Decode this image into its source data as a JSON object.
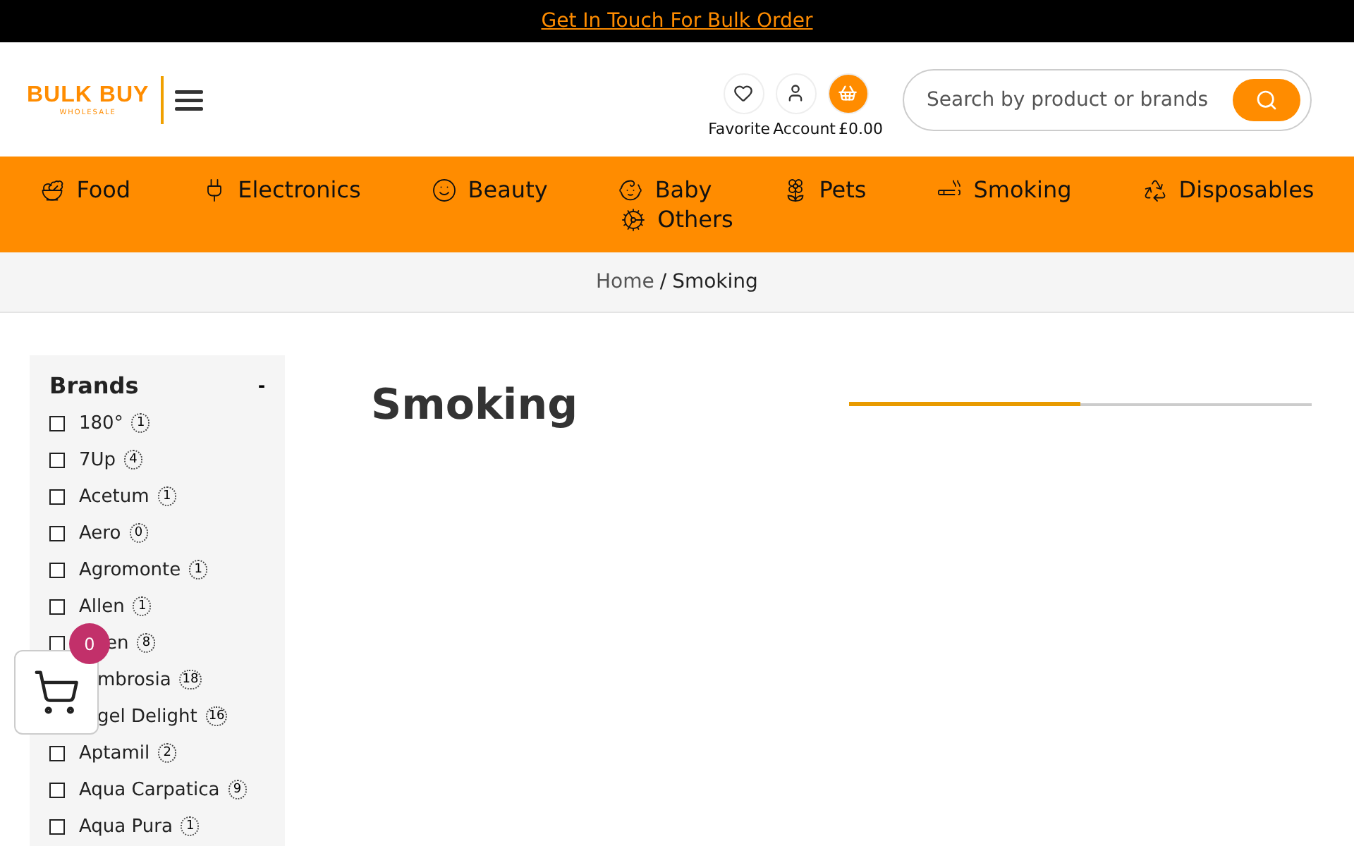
{
  "top_bar": {
    "link": "Get In Touch For Bulk Order"
  },
  "header": {
    "logo": "BULK BUY",
    "logo_sub": "WHOLESALE",
    "actions": [
      {
        "kind": "heart",
        "label": "Favorite"
      },
      {
        "kind": "user",
        "label": "Account"
      },
      {
        "kind": "basket",
        "label": "£0.00"
      }
    ],
    "search": {
      "placeholder": "Search by product or brands"
    }
  },
  "nav": [
    {
      "kind": "food",
      "label": "Food"
    },
    {
      "kind": "electronics",
      "label": "Electronics"
    },
    {
      "kind": "beauty",
      "label": "Beauty"
    },
    {
      "kind": "baby",
      "label": "Baby"
    },
    {
      "kind": "pets",
      "label": "Pets"
    },
    {
      "kind": "smoking",
      "label": "Smoking"
    },
    {
      "kind": "disposables",
      "label": "Disposables"
    },
    {
      "kind": "others",
      "label": "Others"
    }
  ],
  "breadcrumb": {
    "home": "Home",
    "separator": "/",
    "current": "Smoking"
  },
  "sidebar": {
    "title": "Brands",
    "toggle": "-",
    "items": [
      {
        "kind": "row",
        "name": "180°",
        "count": "1",
        "checked": false
      },
      {
        "kind": "row",
        "name": "7Up",
        "count": "4",
        "checked": false
      },
      {
        "kind": "row",
        "name": "Acetum",
        "count": "1",
        "checked": false
      },
      {
        "kind": "row",
        "name": "Aero",
        "count": "0",
        "checked": false
      },
      {
        "kind": "row",
        "name": "Agromonte",
        "count": "1",
        "checked": false
      },
      {
        "kind": "row",
        "name": "Allen",
        "count": "1",
        "checked": false
      },
      {
        "kind": "tail",
        "name": "en",
        "count": "8",
        "checked": false
      },
      {
        "kind": "fragment",
        "name": "mbrosia",
        "count": "18"
      },
      {
        "kind": "fragment",
        "name": "gel Delight",
        "count": "16"
      },
      {
        "kind": "row",
        "name": "Aptamil",
        "count": "2",
        "checked": false
      },
      {
        "kind": "row",
        "name": "Aqua Carpatica",
        "count": "9",
        "checked": false
      },
      {
        "kind": "row",
        "name": "Aqua Pura",
        "count": "1",
        "checked": false
      }
    ]
  },
  "page_title": "Smoking",
  "floating_cart": {
    "count": "0"
  }
}
